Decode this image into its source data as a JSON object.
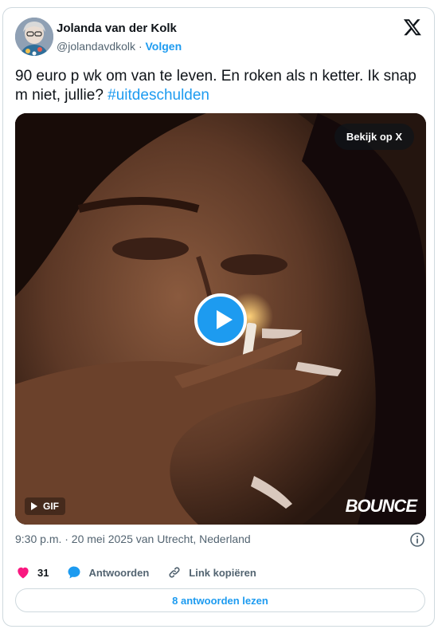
{
  "author": {
    "name": "Jolanda van der Kolk",
    "handle": "@jolandavdkolk",
    "separator": "·",
    "follow_label": "Volgen"
  },
  "tweet": {
    "text": "90 euro p wk om van te leven. En roken als n ketter. Ik snap m niet, jullie?",
    "hashtag": "#uitdeschulden"
  },
  "media": {
    "view_on_x_label": "Bekijk op X",
    "gif_badge": "GIF",
    "watermark": "BOUNCE"
  },
  "meta": {
    "timestamp": "9:30 p.m. · 20 mei 2025 van Utrecht, Nederland"
  },
  "actions": {
    "likes": "31",
    "reply_label": "Antwoorden",
    "copy_link_label": "Link kopiëren"
  },
  "read_replies_label": "8 antwoorden lezen",
  "colors": {
    "accent": "#1d9bf0",
    "like": "#f91880",
    "text": "#0f1419",
    "muted": "#536471",
    "border": "#cfd9de"
  },
  "icons": [
    "x-logo-icon",
    "play-icon",
    "gif-play-icon",
    "info-icon",
    "heart-icon",
    "reply-bubble-icon",
    "link-icon"
  ]
}
